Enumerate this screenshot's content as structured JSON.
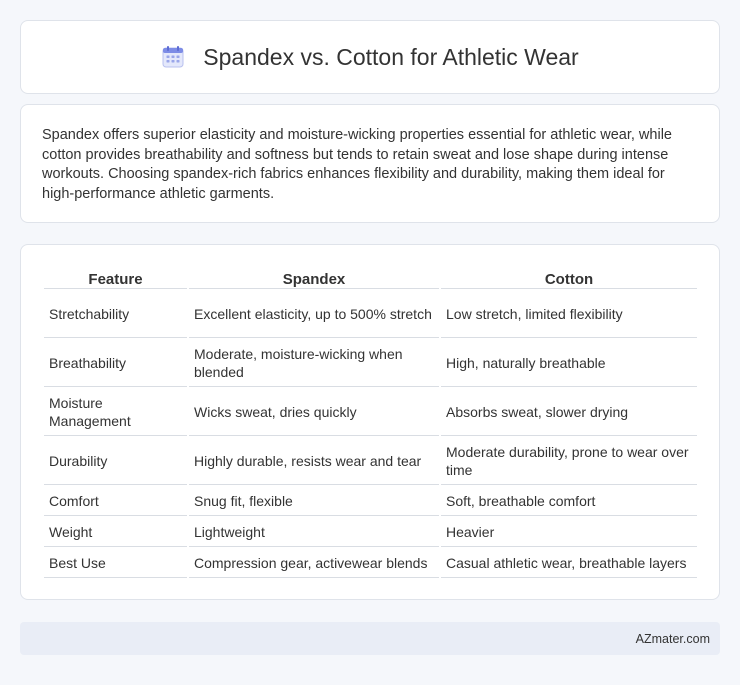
{
  "header": {
    "title": "Spandex vs. Cotton for Athletic Wear",
    "icon": "calendar-icon"
  },
  "intro": {
    "text": "Spandex offers superior elasticity and moisture-wicking properties essential for athletic wear, while cotton provides breathability and softness but tends to retain sweat and lose shape during intense workouts. Choosing spandex-rich fabrics enhances flexibility and durability, making them ideal for high-performance athletic garments."
  },
  "table": {
    "headers": [
      "Feature",
      "Spandex",
      "Cotton"
    ],
    "rows": [
      [
        "Stretchability",
        "Excellent elasticity, up to 500% stretch",
        "Low stretch, limited flexibility"
      ],
      [
        "Breathability",
        "Moderate, moisture-wicking when blended",
        "High, naturally breathable"
      ],
      [
        "Moisture Management",
        "Wicks sweat, dries quickly",
        "Absorbs sweat, slower drying"
      ],
      [
        "Durability",
        "Highly durable, resists wear and tear",
        "Moderate durability, prone to wear over time"
      ],
      [
        "Comfort",
        "Snug fit, flexible",
        "Soft, breathable comfort"
      ],
      [
        "Weight",
        "Lightweight",
        "Heavier"
      ],
      [
        "Best Use",
        "Compression gear, activewear blends",
        "Casual athletic wear, breathable layers"
      ]
    ]
  },
  "footer": {
    "text": "AZmater.com"
  },
  "colors": {
    "background": "#f5f7fb",
    "icon_accent": "#6f7fe0",
    "footer_bg": "#e9edf6"
  }
}
